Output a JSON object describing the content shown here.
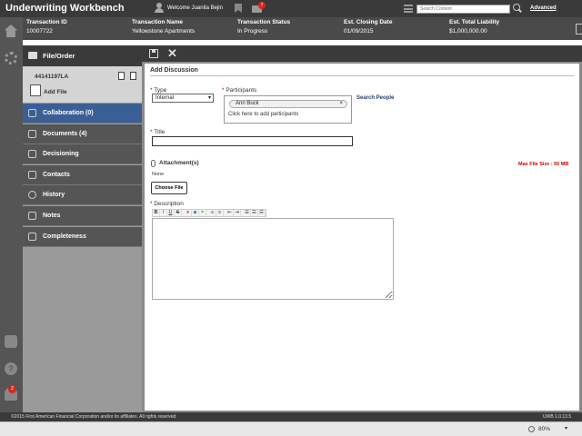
{
  "app": {
    "title": "Underwriting Workbench",
    "welcome": "Welcome Juanita Bejin",
    "mail_count": "7",
    "search_placeholder": "Search Content",
    "advanced_label": "Advanced"
  },
  "transaction": {
    "columns": [
      {
        "header": "Transaction ID",
        "value": "10007722"
      },
      {
        "header": "Transaction Name",
        "value": "Yellowstone Apartments"
      },
      {
        "header": "Transaction Status",
        "value": "In Progress"
      },
      {
        "header": "Est. Closing Date",
        "value": "01/09/2015"
      },
      {
        "header": "Est. Total Liability",
        "value": "$1,000,000.00"
      }
    ]
  },
  "sidebar": {
    "file_order_label": "File/Order",
    "file_number": "44141197LA",
    "add_file_label": "Add File",
    "items": [
      {
        "label": "Collaboration (0)",
        "icon": "collaboration-icon",
        "active": true
      },
      {
        "label": "Documents (4)",
        "icon": "paperclip-icon",
        "active": false
      },
      {
        "label": "Decisioning",
        "icon": "gavel-icon",
        "active": false
      },
      {
        "label": "Contacts",
        "icon": "contacts-icon",
        "active": false
      },
      {
        "label": "History",
        "icon": "clock-icon",
        "active": false
      },
      {
        "label": "Notes",
        "icon": "notes-icon",
        "active": false
      },
      {
        "label": "Completeness",
        "icon": "checklist-icon",
        "active": false
      }
    ]
  },
  "form": {
    "title": "Add Discussion",
    "type_label": "Type",
    "type_value": "Internal",
    "participants_label": "Participants",
    "participant_chip": "Ann Buck",
    "participants_hint": "Click here to add participants",
    "search_people": "Search People",
    "title_label": "Title",
    "attachments_label": "Attachment(s)",
    "max_file_size": "Max File Size : 50 MB",
    "attachments_none": "None",
    "choose_file": "Choose File",
    "description_label": "Description",
    "required_marker": "*"
  },
  "footer": {
    "copyright": "©2015 First American Financial Corporation and/or its affiliates. All rights reserved.",
    "version": "UWB 1.0.13.5"
  },
  "browser": {
    "zoom": "80%"
  },
  "badges": {
    "notifications": "2"
  }
}
